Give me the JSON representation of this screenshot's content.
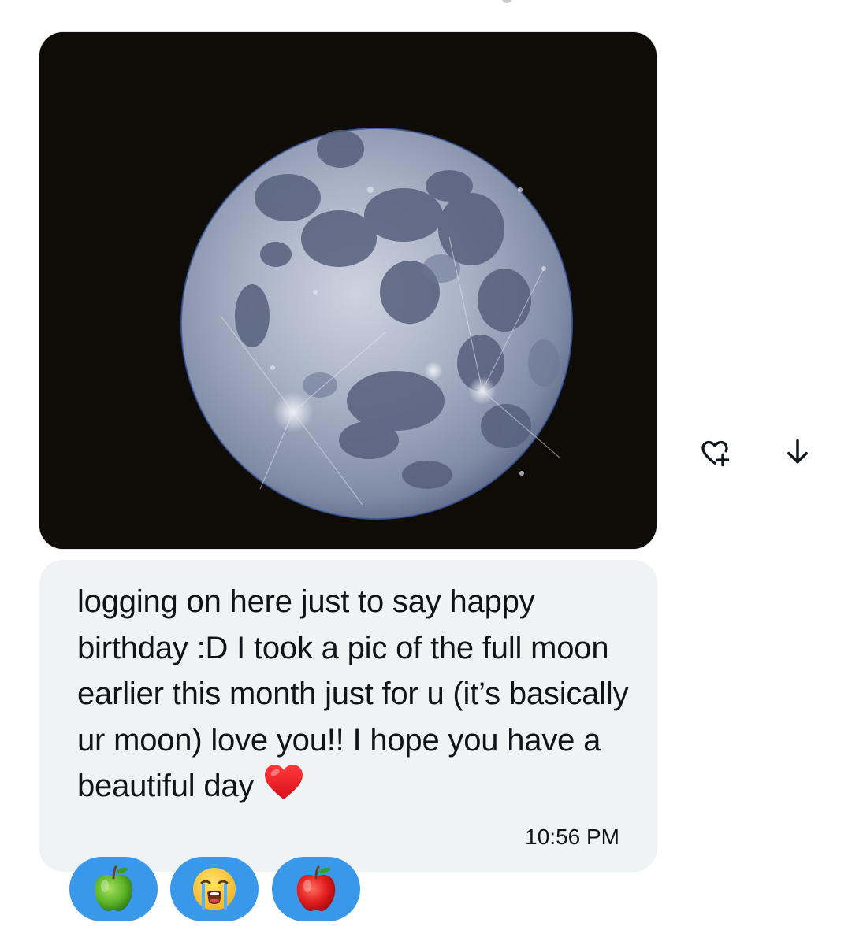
{
  "message": {
    "text": "logging on here just to say happy birthday :D I took a pic of the full moon earlier this month just for u (it’s basically ur moon) love you!! I hope you have a beautiful day",
    "timestamp": "10:56 PM",
    "end_emoji": "red-heart"
  },
  "actions": [
    {
      "name": "add-reaction",
      "icon": "heart-plus-icon"
    },
    {
      "name": "download",
      "icon": "arrow-down-icon"
    }
  ],
  "reactions": [
    {
      "emoji": "green-apple"
    },
    {
      "emoji": "loudly-crying-face"
    },
    {
      "emoji": "red-apple"
    }
  ],
  "colors": {
    "bubble": "#eff3f4",
    "text": "#0f1419",
    "reaction_pill": "#3a98ea",
    "photo_background": "#0f0c08",
    "moon": "#9aa6bd"
  }
}
